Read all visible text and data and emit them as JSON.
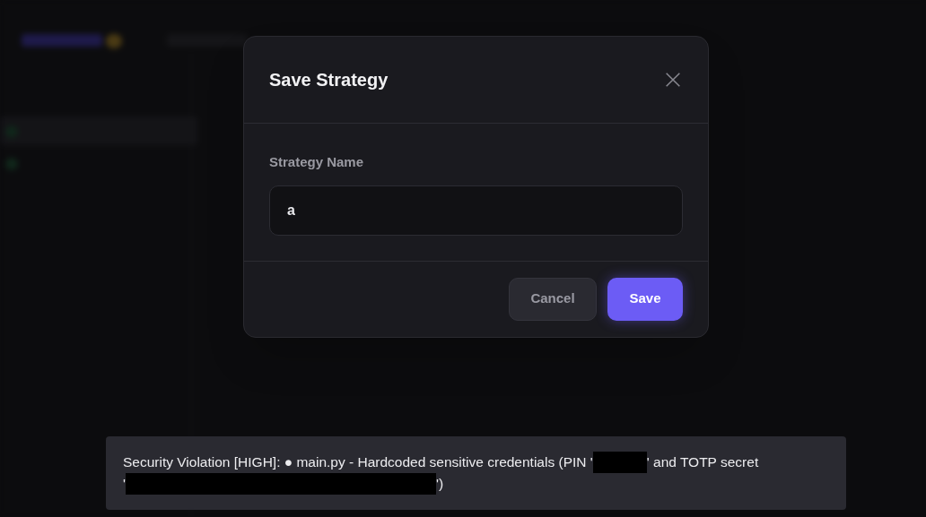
{
  "dialog": {
    "title": "Save Strategy",
    "field": {
      "label": "Strategy Name",
      "value": "a"
    },
    "buttons": [
      {
        "kind": "secondary",
        "label": "Cancel"
      },
      {
        "kind": "primary",
        "label": "Save"
      }
    ]
  },
  "toast": {
    "lines": [
      [
        {
          "kind": "text",
          "text": "Security Violation [HIGH]: ● main.py - Hardcoded sensitive credentials (PIN '"
        },
        {
          "kind": "redacted_short"
        },
        {
          "kind": "text",
          "text": "' and TOTP secret"
        }
      ],
      [
        {
          "kind": "text",
          "text": "'"
        },
        {
          "kind": "redacted_long"
        },
        {
          "kind": "text",
          "text": "')"
        }
      ]
    ]
  }
}
